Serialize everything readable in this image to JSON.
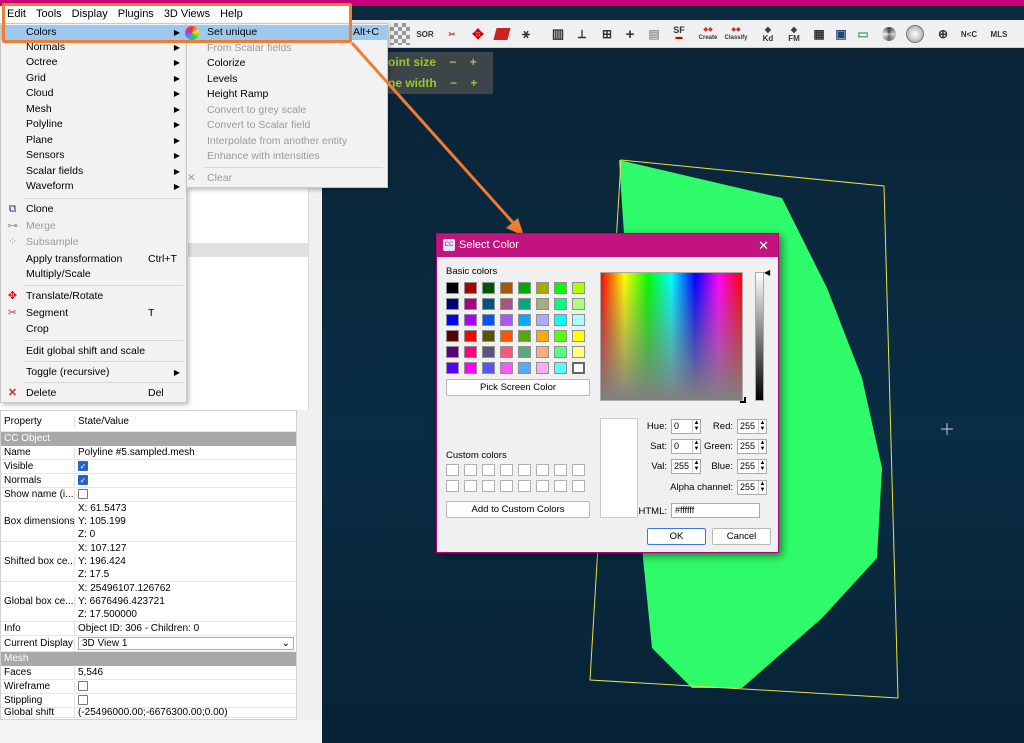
{
  "menubar": {
    "items": [
      "Edit",
      "Tools",
      "Display",
      "Plugins",
      "3D Views",
      "Help"
    ]
  },
  "toolbar": {
    "sor": "SOR",
    "sf": "SF",
    "canupo_create": "Create",
    "canupo_classify": "Classify",
    "kd": "Kd",
    "fm": "FM",
    "nc": "N<C",
    "mls": "MLS"
  },
  "edit_menu": {
    "items": [
      {
        "label": "Colors",
        "submenu": true,
        "enabled": true
      },
      {
        "label": "Normals",
        "submenu": true,
        "enabled": true
      },
      {
        "label": "Octree",
        "submenu": true,
        "enabled": true
      },
      {
        "label": "Grid",
        "submenu": true,
        "enabled": true
      },
      {
        "label": "Cloud",
        "submenu": true,
        "enabled": true
      },
      {
        "label": "Mesh",
        "submenu": true,
        "enabled": true
      },
      {
        "label": "Polyline",
        "submenu": true,
        "enabled": true
      },
      {
        "label": "Plane",
        "submenu": true,
        "enabled": true
      },
      {
        "label": "Sensors",
        "submenu": true,
        "enabled": true
      },
      {
        "label": "Scalar fields",
        "submenu": true,
        "enabled": true
      },
      {
        "label": "Waveform",
        "submenu": true,
        "enabled": true
      },
      {
        "label": "Clone",
        "enabled": true
      },
      {
        "label": "Merge",
        "enabled": false
      },
      {
        "label": "Subsample",
        "enabled": false
      },
      {
        "label": "Apply transformation",
        "shortcut": "Ctrl+T",
        "enabled": true
      },
      {
        "label": "Multiply/Scale",
        "enabled": true
      },
      {
        "label": "Translate/Rotate",
        "enabled": true
      },
      {
        "label": "Segment",
        "shortcut": "T",
        "enabled": true
      },
      {
        "label": "Crop",
        "enabled": true
      },
      {
        "label": "Edit global shift and scale",
        "enabled": true
      },
      {
        "label": "Toggle (recursive)",
        "submenu": true,
        "enabled": true
      },
      {
        "label": "Delete",
        "shortcut": "Del",
        "enabled": true
      }
    ]
  },
  "colors_submenu": {
    "items": [
      {
        "label": "Set unique",
        "shortcut": "Alt+C",
        "enabled": true
      },
      {
        "label": "From Scalar fields",
        "enabled": false
      },
      {
        "label": "Colorize",
        "enabled": true
      },
      {
        "label": "Levels",
        "enabled": true
      },
      {
        "label": "Height Ramp",
        "enabled": true
      },
      {
        "label": "Convert to grey scale",
        "enabled": false
      },
      {
        "label": "Convert to Scalar field",
        "enabled": false
      },
      {
        "label": "Interpolate from another entity",
        "enabled": false
      },
      {
        "label": "Enhance with intensities",
        "enabled": false
      },
      {
        "label": "Clear",
        "enabled": false
      }
    ]
  },
  "overlay": {
    "point_size": "oint size",
    "line_width": "ne width",
    "minus": "−",
    "plus": "+"
  },
  "properties": {
    "title": "roperties",
    "header": {
      "property": "Property",
      "value": "State/Value"
    },
    "section_cc": "CC Object",
    "name_k": "Name",
    "name_v": "Polyline #5.sampled.mesh",
    "visible_k": "Visible",
    "normals_k": "Normals",
    "showname_k": "Show name (i...",
    "boxdim_k": "Box dimensions",
    "boxdim_x": "X: 61.5473",
    "boxdim_y": "Y: 105.199",
    "boxdim_z": "Z: 0",
    "shifted_k": "Shifted box ce...",
    "shifted_x": "X: 107.127",
    "shifted_y": "Y: 196.424",
    "shifted_z": "Z: 17.5",
    "global_k": "Global box ce...",
    "global_x": "X: 25496107.126762",
    "global_y": "Y: 6676496.423721",
    "global_z": "Z: 17.500000",
    "info_k": "Info",
    "info_v": "Object ID: 306 - Children: 0",
    "display_k": "Current Display",
    "display_v": "3D View 1",
    "section_mesh": "Mesh",
    "faces_k": "Faces",
    "faces_v": "5,546",
    "wire_k": "Wireframe",
    "stip_k": "Stippling",
    "gshift_k": "Global shift",
    "gshift_v": "(-25496000.00;-6676300.00;0.00)"
  },
  "dialog": {
    "title": "Select Color",
    "basic_colors_label": "Basic colors",
    "pick_screen": "Pick Screen Color",
    "custom_colors_label": "Custom colors",
    "add_custom": "Add to Custom Colors",
    "hue_label": "Hue:",
    "hue": "0",
    "sat_label": "Sat:",
    "sat": "0",
    "val_label": "Val:",
    "val": "255",
    "red_label": "Red:",
    "red": "255",
    "green_label": "Green:",
    "green": "255",
    "blue_label": "Blue:",
    "blue": "255",
    "alpha_label": "Alpha channel:",
    "alpha": "255",
    "html_label": "HTML:",
    "html": "#ffffff",
    "ok": "OK",
    "cancel": "Cancel",
    "basic_colors": [
      "#000000",
      "#aa0000",
      "#005500",
      "#aa5500",
      "#00aa00",
      "#aaaa00",
      "#00ff00",
      "#aaff00",
      "#00007f",
      "#aa007f",
      "#00557f",
      "#aa557f",
      "#00aa7f",
      "#aaaa7f",
      "#00ff7f",
      "#aaff7f",
      "#0000ff",
      "#aa00ff",
      "#0055ff",
      "#aa55ff",
      "#00aaff",
      "#aaaaff",
      "#00ffff",
      "#aaffff",
      "#550000",
      "#ff0000",
      "#555500",
      "#ff5500",
      "#55aa00",
      "#ffaa00",
      "#55ff00",
      "#ffff00",
      "#55007f",
      "#ff007f",
      "#55557f",
      "#ff557f",
      "#55aa7f",
      "#ffaa7f",
      "#55ff7f",
      "#ffff7f",
      "#5500ff",
      "#ff00ff",
      "#5555ff",
      "#ff55ff",
      "#55aaff",
      "#ffaaff",
      "#55ffff",
      "#ffffff"
    ]
  }
}
